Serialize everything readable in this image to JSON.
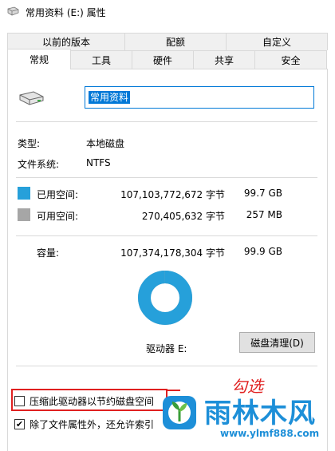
{
  "window": {
    "title": "常用资料 (E:) 属性"
  },
  "tabs": {
    "back_row": [
      "以前的版本",
      "配额",
      "自定义"
    ],
    "front_row": [
      "常规",
      "工具",
      "硬件",
      "共享",
      "安全"
    ]
  },
  "general": {
    "drive_name": "常用资料",
    "type_label": "类型:",
    "type_value": "本地磁盘",
    "fs_label": "文件系统:",
    "fs_value": "NTFS",
    "used_label": "已用空间:",
    "used_bytes": "107,103,772,672 字节",
    "used_size": "99.7 GB",
    "free_label": "可用空间:",
    "free_bytes": "270,405,632 字节",
    "free_size": "257 MB",
    "capacity_label": "容量:",
    "capacity_bytes": "107,374,178,304 字节",
    "capacity_size": "99.9 GB",
    "drive_letter": "驱动器 E:",
    "cleanup_button": "磁盘清理(D)",
    "used_fraction": 0.9975
  },
  "options": {
    "compress_label": "压缩此驱动器以节约磁盘空间",
    "compress_checked": false,
    "index_label": "除了文件属性外，还允许索引",
    "index_checked": true
  },
  "annotation": {
    "note": "勾选"
  },
  "watermark": {
    "brand": "雨林木风",
    "url": "www.ylmf888.com"
  },
  "colors": {
    "used": "#26a0da",
    "free": "#a6a6a6",
    "accent": "#0078d7",
    "highlight": "#e02020",
    "brand": "#1d8fd8"
  }
}
